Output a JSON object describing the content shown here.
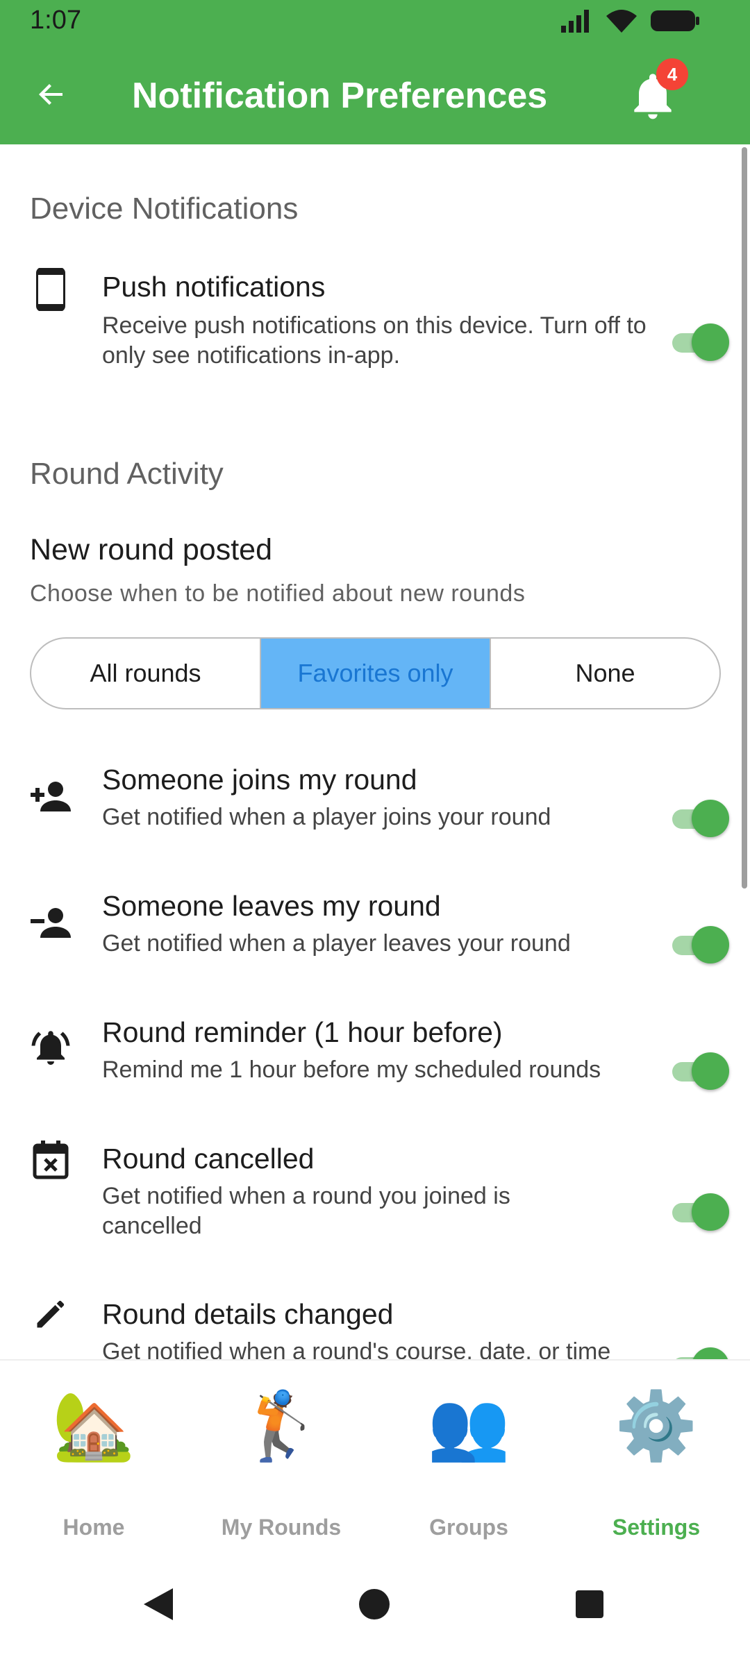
{
  "status": {
    "time": "1:07"
  },
  "appbar": {
    "title": "Notification Preferences",
    "badge_count": "4"
  },
  "device_section": {
    "header": "Device Notifications",
    "push": {
      "title": "Push notifications",
      "subtitle": "Receive push notifications on this device. Turn off to only see notifications in-app.",
      "enabled": true
    }
  },
  "round_section": {
    "header": "Round Activity",
    "new_round": {
      "title": "New round posted",
      "subtitle": "Choose when to be notified about new rounds",
      "options": [
        "All rounds",
        "Favorites only",
        "None"
      ],
      "selected": "Favorites only"
    },
    "items": [
      {
        "title": "Someone joins my round",
        "subtitle": "Get notified when a player joins your round",
        "icon": "person-add-icon",
        "enabled": true
      },
      {
        "title": "Someone leaves my round",
        "subtitle": "Get notified when a player leaves your round",
        "icon": "person-remove-icon",
        "enabled": true
      },
      {
        "title": "Round reminder (1 hour before)",
        "subtitle": "Remind me 1 hour before my scheduled rounds",
        "icon": "alarm-bell-icon",
        "enabled": true
      },
      {
        "title": "Round cancelled",
        "subtitle": "Get notified when a round you joined is cancelled",
        "icon": "calendar-cancel-icon",
        "enabled": true
      },
      {
        "title": "Round details changed",
        "subtitle": "Get notified when a round's course, date, or time",
        "icon": "pencil-icon",
        "enabled": true
      }
    ]
  },
  "bottom_nav": {
    "items": [
      {
        "label": "Home",
        "icon": "house-icon",
        "emoji": "🏡"
      },
      {
        "label": "My Rounds",
        "icon": "golfer-icon",
        "emoji": "🏌️"
      },
      {
        "label": "Groups",
        "icon": "people-icon",
        "emoji": "👥"
      },
      {
        "label": "Settings",
        "icon": "gear-icon",
        "emoji": "⚙️"
      }
    ],
    "active": "Settings"
  },
  "colors": {
    "primary": "#4caf50",
    "toggle_track": "#a5d6a7",
    "segment_active": "#64b5f6",
    "badge": "#f44336"
  }
}
